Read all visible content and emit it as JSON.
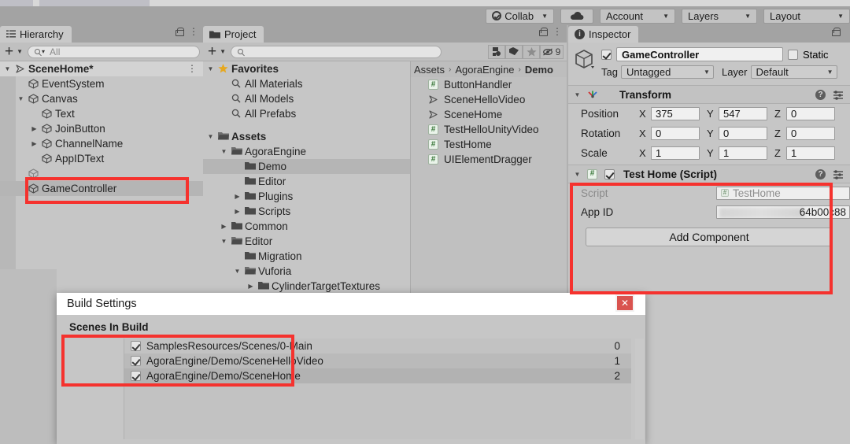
{
  "toolbar": {
    "collab_label": "Collab",
    "cloud_label": "",
    "account_label": "Account",
    "layers_label": "Layers",
    "layout_label": "Layout",
    "caret": "▼"
  },
  "hierarchy": {
    "tab_label": "Hierarchy",
    "create_label": "+",
    "search_placeholder": "All",
    "items": [
      {
        "label": "SceneHome*",
        "indent": 0,
        "icon": "scene-icon",
        "arrow": "▼",
        "bold": true,
        "selected": false,
        "root": true
      },
      {
        "label": "EventSystem",
        "indent": 1,
        "icon": "cube-icon",
        "arrow": "",
        "bold": false,
        "selected": false,
        "root": false
      },
      {
        "label": "Canvas",
        "indent": 1,
        "icon": "cube-icon",
        "arrow": "▼",
        "bold": false,
        "selected": false,
        "root": false
      },
      {
        "label": "Text",
        "indent": 2,
        "icon": "cube-icon",
        "arrow": "",
        "bold": false,
        "selected": false,
        "root": false
      },
      {
        "label": "JoinButton",
        "indent": 2,
        "icon": "cube-icon",
        "arrow": "▶",
        "bold": false,
        "selected": false,
        "root": false
      },
      {
        "label": "ChannelName",
        "indent": 2,
        "icon": "cube-icon",
        "arrow": "▶",
        "bold": false,
        "selected": false,
        "root": false
      },
      {
        "label": "AppIDText",
        "indent": 2,
        "icon": "cube-icon",
        "arrow": "",
        "bold": false,
        "selected": false,
        "root": false
      },
      {
        "label": "",
        "indent": 1,
        "icon": "cube-icon",
        "arrow": "",
        "bold": false,
        "selected": false,
        "root": false
      },
      {
        "label": "GameController",
        "indent": 1,
        "icon": "cube-icon",
        "arrow": "",
        "bold": false,
        "selected": true,
        "root": false
      }
    ]
  },
  "project": {
    "tab_label": "Project",
    "create_label": "+",
    "search_placeholder": "",
    "tool_icons": [
      "save-search-icon",
      "label-icon",
      "star-icon",
      "hidden-icon"
    ],
    "hidden_count": "9",
    "tree": [
      {
        "label": "Favorites",
        "indent": 0,
        "icon": "star-icon",
        "arrow": "▼",
        "bold": true,
        "selected": false
      },
      {
        "label": "All Materials",
        "indent": 1,
        "icon": "search-icon",
        "arrow": "",
        "bold": false,
        "selected": false
      },
      {
        "label": "All Models",
        "indent": 1,
        "icon": "search-icon",
        "arrow": "",
        "bold": false,
        "selected": false
      },
      {
        "label": "All Prefabs",
        "indent": 1,
        "icon": "search-icon",
        "arrow": "",
        "bold": false,
        "selected": false
      },
      {
        "label": "",
        "indent": 0,
        "icon": "",
        "arrow": "",
        "bold": false,
        "selected": false
      },
      {
        "label": "Assets",
        "indent": 0,
        "icon": "folder-open-icon",
        "arrow": "▼",
        "bold": true,
        "selected": false
      },
      {
        "label": "AgoraEngine",
        "indent": 1,
        "icon": "folder-open-icon",
        "arrow": "▼",
        "bold": false,
        "selected": false
      },
      {
        "label": "Demo",
        "indent": 2,
        "icon": "folder-icon",
        "arrow": "",
        "bold": false,
        "selected": true
      },
      {
        "label": "Editor",
        "indent": 2,
        "icon": "folder-icon",
        "arrow": "",
        "bold": false,
        "selected": false
      },
      {
        "label": "Plugins",
        "indent": 2,
        "icon": "folder-icon",
        "arrow": "▶",
        "bold": false,
        "selected": false
      },
      {
        "label": "Scripts",
        "indent": 2,
        "icon": "folder-icon",
        "arrow": "▶",
        "bold": false,
        "selected": false
      },
      {
        "label": "Common",
        "indent": 1,
        "icon": "folder-icon",
        "arrow": "▶",
        "bold": false,
        "selected": false
      },
      {
        "label": "Editor",
        "indent": 1,
        "icon": "folder-open-icon",
        "arrow": "▼",
        "bold": false,
        "selected": false
      },
      {
        "label": "Migration",
        "indent": 2,
        "icon": "folder-icon",
        "arrow": "",
        "bold": false,
        "selected": false
      },
      {
        "label": "Vuforia",
        "indent": 2,
        "icon": "folder-open-icon",
        "arrow": "▼",
        "bold": false,
        "selected": false
      },
      {
        "label": "CylinderTargetTextures",
        "indent": 3,
        "icon": "folder-icon",
        "arrow": "▶",
        "bold": false,
        "selected": false
      }
    ],
    "breadcrumb": [
      "Assets",
      "AgoraEngine",
      "Demo"
    ],
    "breadcrumb_sep": "›",
    "files": [
      {
        "label": "ButtonHandler",
        "icon": "csharp-script-icon"
      },
      {
        "label": "SceneHelloVideo",
        "icon": "scene-icon"
      },
      {
        "label": "SceneHome",
        "icon": "scene-icon"
      },
      {
        "label": "TestHelloUnityVideo",
        "icon": "csharp-script-icon"
      },
      {
        "label": "TestHome",
        "icon": "csharp-script-icon"
      },
      {
        "label": "UIElementDragger",
        "icon": "csharp-script-icon"
      }
    ]
  },
  "inspector": {
    "tab_label": "Inspector",
    "object_name": "GameController",
    "object_enabled": true,
    "static_label": "Static",
    "static_checked": false,
    "tag_label": "Tag",
    "tag_value": "Untagged",
    "layer_label": "Layer",
    "layer_value": "Default",
    "transform": {
      "title": "Transform",
      "rows": [
        {
          "label": "Position",
          "x": "375",
          "y": "547",
          "z": "0"
        },
        {
          "label": "Rotation",
          "x": "0",
          "y": "0",
          "z": "0"
        },
        {
          "label": "Scale",
          "x": "1",
          "y": "1",
          "z": "1"
        }
      ],
      "axis_labels": [
        "X",
        "Y",
        "Z"
      ]
    },
    "script_component": {
      "title": "Test Home (Script)",
      "enabled": true,
      "script_label": "Script",
      "script_value": "TestHome",
      "appid_label": "App ID",
      "appid_value": "64b00c88"
    },
    "add_component_label": "Add Component"
  },
  "build_settings": {
    "title": "Build Settings",
    "close_label": "✕",
    "section_label": "Scenes In Build",
    "scenes": [
      {
        "path": "SamplesResources/Scenes/0-Main",
        "enabled": true,
        "index": "0"
      },
      {
        "path": "AgoraEngine/Demo/SceneHelloVideo",
        "enabled": true,
        "index": "1"
      },
      {
        "path": "AgoraEngine/Demo/SceneHome",
        "enabled": true,
        "index": "2"
      }
    ]
  },
  "annotations": {
    "highlight_color": "#f5322e",
    "boxes": [
      "game-controller-row",
      "test-home-script-component",
      "scenes-in-build-list"
    ]
  }
}
